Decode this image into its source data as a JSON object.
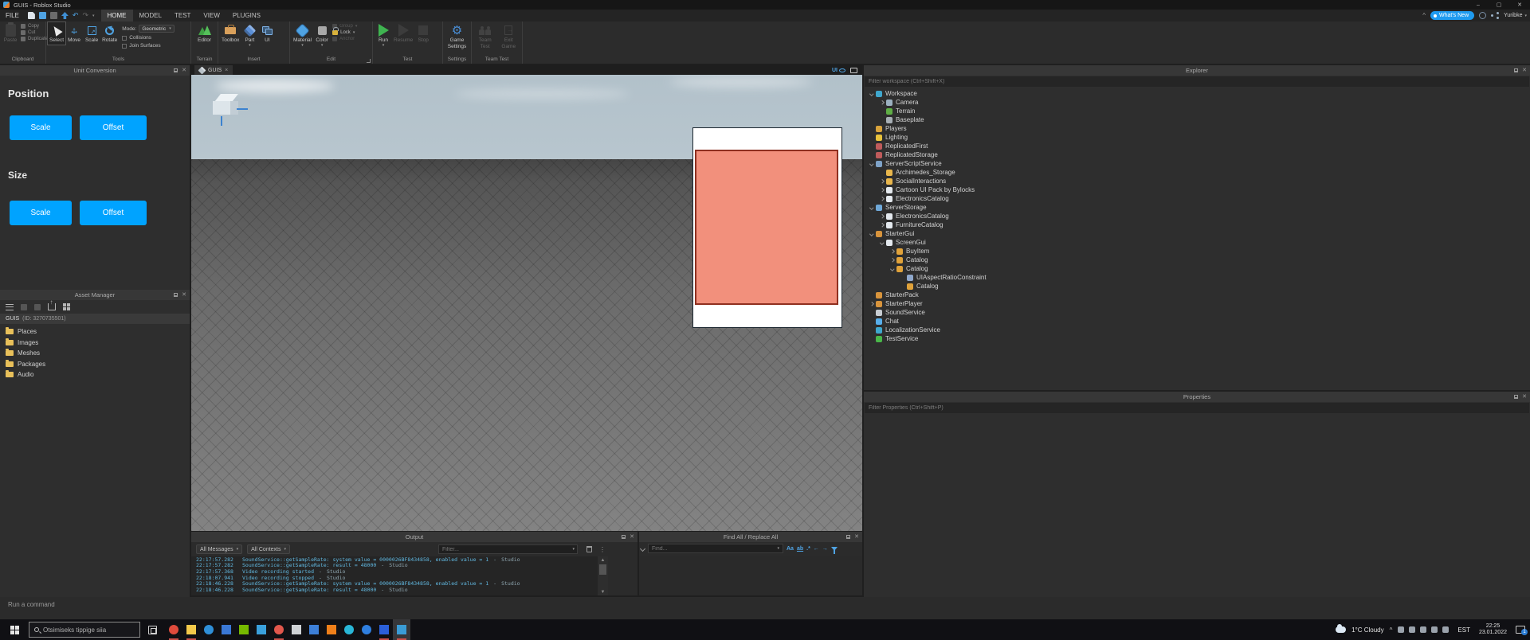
{
  "window": {
    "title": "GUIS - Roblox Studio",
    "minimize": "–",
    "maximize": "▢",
    "close": "✕"
  },
  "menu": {
    "file": "FILE",
    "tabs": [
      "HOME",
      "MODEL",
      "TEST",
      "VIEW",
      "PLUGINS"
    ],
    "active_tab": "HOME",
    "whats_new": "What's New",
    "user": "Yuribke"
  },
  "ribbon": {
    "sections": {
      "clipboard": "Clipboard",
      "tools": "Tools",
      "terrain": "Terrain",
      "insert": "Insert",
      "edit": "Edit",
      "test": "Test",
      "settings": "Settings",
      "team_test": "Team Test"
    },
    "buttons": {
      "paste": "Paste",
      "copy": "Copy",
      "cut": "Cut",
      "duplicate": "Duplicate",
      "select": "Select",
      "move": "Move",
      "scale": "Scale",
      "rotate": "Rotate",
      "editor": "Editor",
      "toolbox": "Toolbox",
      "part": "Part",
      "ui": "UI",
      "material": "Material",
      "color": "Color",
      "group": "Group",
      "lock": "Lock",
      "anchor": "Anchor",
      "run": "Run",
      "resume": "Resume",
      "stop": "Stop",
      "game_settings": "Game Settings",
      "team_test": "Team Test",
      "exit_game": "Exit Game"
    },
    "mode_label": "Mode:",
    "mode_value": "Geometric",
    "collisions": "Collisions",
    "join_surfaces": "Join Surfaces"
  },
  "unit_conversion": {
    "title": "Unit Conversion",
    "position_heading": "Position",
    "size_heading": "Size",
    "scale_button": "Scale",
    "offset_button": "Offset"
  },
  "asset_manager": {
    "title": "Asset Manager",
    "breadcrumb_name": "GUIS",
    "breadcrumb_id": "(ID: 3270735501)",
    "folders": [
      {
        "label": "Places"
      },
      {
        "label": "Images"
      },
      {
        "label": "Meshes"
      },
      {
        "label": "Packages"
      },
      {
        "label": "Audio"
      }
    ]
  },
  "viewport": {
    "tab": "GUIS",
    "tab_close": "×",
    "ui_toggle": "UI"
  },
  "explorer": {
    "title": "Explorer",
    "filter_placeholder": "Filter workspace (Ctrl+Shift+X)",
    "items": [
      {
        "label": "Workspace",
        "depth": 0,
        "exp": "open",
        "color": "#3fa7ce"
      },
      {
        "label": "Camera",
        "depth": 1,
        "exp": "closed",
        "color": "#9bb0c0"
      },
      {
        "label": "Terrain",
        "depth": 1,
        "exp": "none",
        "color": "#5fae45"
      },
      {
        "label": "Baseplate",
        "depth": 1,
        "exp": "none",
        "color": "#a7afb5"
      },
      {
        "label": "Players",
        "depth": 0,
        "exp": "none",
        "color": "#d8a33c"
      },
      {
        "label": "Lighting",
        "depth": 0,
        "exp": "none",
        "color": "#e8c23c"
      },
      {
        "label": "ReplicatedFirst",
        "depth": 0,
        "exp": "none",
        "color": "#bf5b5b"
      },
      {
        "label": "ReplicatedStorage",
        "depth": 0,
        "exp": "none",
        "color": "#bf5b5b"
      },
      {
        "label": "ServerScriptService",
        "depth": 0,
        "exp": "open",
        "color": "#7fa3c8"
      },
      {
        "label": "Archimedes_Storage",
        "depth": 1,
        "exp": "none",
        "color": "#e8b64c"
      },
      {
        "label": "SocialInteractions",
        "depth": 1,
        "exp": "closed",
        "color": "#e8b64c"
      },
      {
        "label": "Cartoon UI Pack by Bylocks",
        "depth": 1,
        "exp": "closed",
        "color": "#e4e9ee"
      },
      {
        "label": "ElectronicsCatalog",
        "depth": 1,
        "exp": "closed",
        "color": "#e4e9ee"
      },
      {
        "label": "ServerStorage",
        "depth": 0,
        "exp": "open",
        "color": "#6fa8d8"
      },
      {
        "label": "ElectronicsCatalog",
        "depth": 1,
        "exp": "closed",
        "color": "#e4e9ee"
      },
      {
        "label": "FurnitureCatalog",
        "depth": 1,
        "exp": "closed",
        "color": "#e4e9ee"
      },
      {
        "label": "StarterGui",
        "depth": 0,
        "exp": "open",
        "color": "#d8943c"
      },
      {
        "label": "ScreenGui",
        "depth": 1,
        "exp": "open",
        "color": "#e4e9ee"
      },
      {
        "label": "BuyItem",
        "depth": 2,
        "exp": "closed",
        "color": "#e0a23a"
      },
      {
        "label": "Catalog",
        "depth": 2,
        "exp": "closed",
        "color": "#e0a23a"
      },
      {
        "label": "Catalog",
        "depth": 2,
        "exp": "open",
        "color": "#e0a23a"
      },
      {
        "label": "UIAspectRatioConstraint",
        "depth": 3,
        "exp": "none",
        "color": "#8fa8cc"
      },
      {
        "label": "Catalog",
        "depth": 3,
        "exp": "none",
        "color": "#e0a23a"
      },
      {
        "label": "StarterPack",
        "depth": 0,
        "exp": "none",
        "color": "#d8943c"
      },
      {
        "label": "StarterPlayer",
        "depth": 0,
        "exp": "closed",
        "color": "#d8943c"
      },
      {
        "label": "SoundService",
        "depth": 0,
        "exp": "none",
        "color": "#c8cdd2"
      },
      {
        "label": "Chat",
        "depth": 0,
        "exp": "none",
        "color": "#58aeea"
      },
      {
        "label": "LocalizationService",
        "depth": 0,
        "exp": "none",
        "color": "#3fa7ce"
      },
      {
        "label": "TestService",
        "depth": 0,
        "exp": "none",
        "color": "#49b749"
      }
    ]
  },
  "properties": {
    "title": "Properties",
    "filter_placeholder": "Filter Properties (Ctrl+Shift+P)"
  },
  "output": {
    "title": "Output",
    "messages_dropdown": "All Messages",
    "contexts_dropdown": "All Contexts",
    "filter_placeholder": "Filter...",
    "logs": [
      {
        "time": "22:17:57.282",
        "msg": "SoundService::getSampleRate: system value = 0000026BF8434858, enabled value = 1",
        "sep": "-",
        "src": "Studio"
      },
      {
        "time": "22:17:57.282",
        "msg": "SoundService::getSampleRate: result = 48000",
        "sep": "-",
        "src": "Studio"
      },
      {
        "time": "22:17:57.368",
        "msg": "Video recording started",
        "sep": "-",
        "src": "Studio"
      },
      {
        "time": "22:18:07.941",
        "msg": "Video recording stopped",
        "sep": "-",
        "src": "Studio"
      },
      {
        "time": "22:18:46.228",
        "msg": "SoundService::getSampleRate: system value = 0000026BF8434858, enabled value = 1",
        "sep": "-",
        "src": "Studio"
      },
      {
        "time": "22:18:46.228",
        "msg": "SoundService::getSampleRate: result = 48000",
        "sep": "-",
        "src": "Studio"
      }
    ]
  },
  "find": {
    "title": "Find All / Replace All",
    "placeholder": "Find...",
    "match_case": "Aa",
    "match_word": "ab",
    "regex": ".*"
  },
  "status_bar": {
    "text": "Run a command"
  },
  "taskbar": {
    "search_placeholder": "Otsimiseks tippige siia",
    "apps": [
      {
        "name": "chrome",
        "color": "#e04b3c",
        "round": true,
        "running": true
      },
      {
        "name": "file-explorer",
        "color": "#f3c94a",
        "round": false,
        "running": true
      },
      {
        "name": "edge",
        "color": "#2f8fd8",
        "round": true,
        "running": false
      },
      {
        "name": "microsoft-store",
        "color": "#3a78d6",
        "round": false,
        "running": false
      },
      {
        "name": "nvidia",
        "color": "#76b900",
        "round": false,
        "running": false
      },
      {
        "name": "mail",
        "color": "#3aa0dc",
        "round": false,
        "running": false
      },
      {
        "name": "opera",
        "color": "#e2574c",
        "round": true,
        "running": true
      },
      {
        "name": "eps-viewer",
        "color": "#cfd2d6",
        "round": false,
        "running": false
      },
      {
        "name": "your-phone",
        "color": "#3d7fd8",
        "round": false,
        "running": false
      },
      {
        "name": "vlc",
        "color": "#ef7f1a",
        "round": false,
        "running": false
      },
      {
        "name": "logitech-g",
        "color": "#29b6d8",
        "round": true,
        "running": false
      },
      {
        "name": "todo-check",
        "color": "#2f7fe0",
        "round": true,
        "running": false
      },
      {
        "name": "id-app",
        "color": "#2b5fd9",
        "round": false,
        "running": true
      },
      {
        "name": "roblox-studio",
        "color": "#3a9bd5",
        "round": false,
        "running": true,
        "state": "active"
      }
    ],
    "tray_icons": [
      {
        "name": "security-shield-icon"
      },
      {
        "name": "onedrive-icon"
      },
      {
        "name": "network-icon"
      },
      {
        "name": "volume-icon"
      },
      {
        "name": "eject-icon"
      }
    ],
    "weather": "1°C Cloudy",
    "language": "EST",
    "time": "22:25",
    "date": "23.01.2022",
    "notification_badge": "1"
  }
}
